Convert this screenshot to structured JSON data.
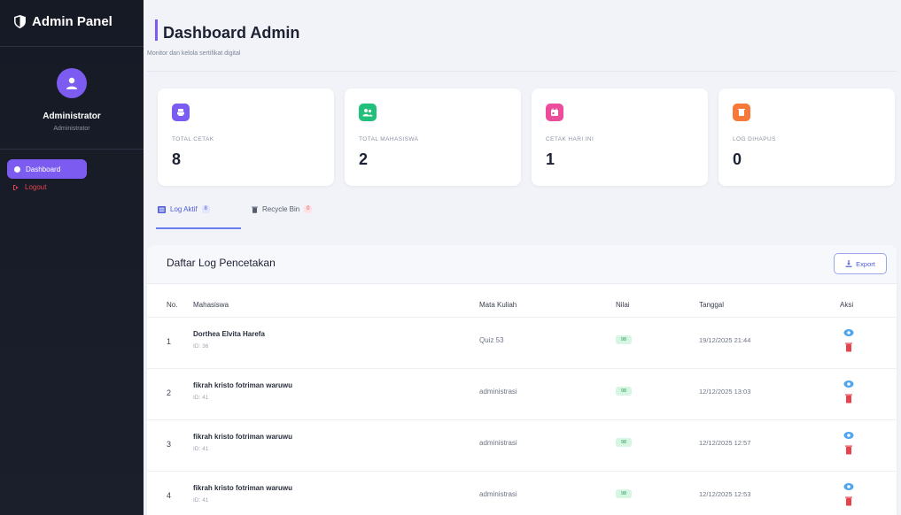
{
  "sidebar": {
    "brand": "Admin Panel",
    "user_name": "Administrator",
    "user_role": "Administrator",
    "nav": [
      {
        "label": "Dashboard",
        "icon": "dashboard-icon",
        "active": true
      },
      {
        "label": "Logout",
        "icon": "logout-icon",
        "active": false
      }
    ]
  },
  "header": {
    "title": "Dashboard Admin",
    "subtitle": "Monitor dan kelola sertifikat digital"
  },
  "stats": [
    {
      "label": "TOTAL CETAK",
      "value": "8",
      "icon": "print-icon",
      "color": "#7c5cf0"
    },
    {
      "label": "TOTAL MAHASISWA",
      "value": "2",
      "icon": "users-icon",
      "color": "#22c07a"
    },
    {
      "label": "CETAK HARI INI",
      "value": "1",
      "icon": "calendar-icon",
      "color": "#ec4d9b"
    },
    {
      "label": "LOG DIHAPUS",
      "value": "0",
      "icon": "trash-icon",
      "color": "#f7793a"
    }
  ],
  "tabs": [
    {
      "label": "Log Aktif",
      "badge": "8",
      "icon": "list-icon"
    },
    {
      "label": "Recycle Bin",
      "badge": "0",
      "icon": "trash-icon"
    }
  ],
  "table": {
    "title": "Daftar Log Pencetakan",
    "export_label": "Export",
    "columns": [
      "No.",
      "Mahasiswa",
      "Mata Kuliah",
      "Nilai",
      "Tanggal",
      "Aksi"
    ],
    "rows": [
      {
        "no": "1",
        "name": "Dorthea Elvita Harefa",
        "id": "ID: 36",
        "mk": "Quiz 53",
        "nilai": "98",
        "tanggal": "19/12/2025 21:44"
      },
      {
        "no": "2",
        "name": "fikrah kristo fotriman waruwu",
        "id": "ID: 41",
        "mk": "administrasi",
        "nilai": "98",
        "tanggal": "12/12/2025 13:03"
      },
      {
        "no": "3",
        "name": "fikrah kristo fotriman waruwu",
        "id": "ID: 41",
        "mk": "administrasi",
        "nilai": "98",
        "tanggal": "12/12/2025 12:57"
      },
      {
        "no": "4",
        "name": "fikrah kristo fotriman waruwu",
        "id": "ID: 41",
        "mk": "administrasi",
        "nilai": "98",
        "tanggal": "12/12/2025 12:53"
      }
    ]
  },
  "colors": {
    "accent": "#7c5cf0",
    "sidebar_bg": "#161a25",
    "danger": "#e5434d",
    "link": "#4c5cd6"
  }
}
